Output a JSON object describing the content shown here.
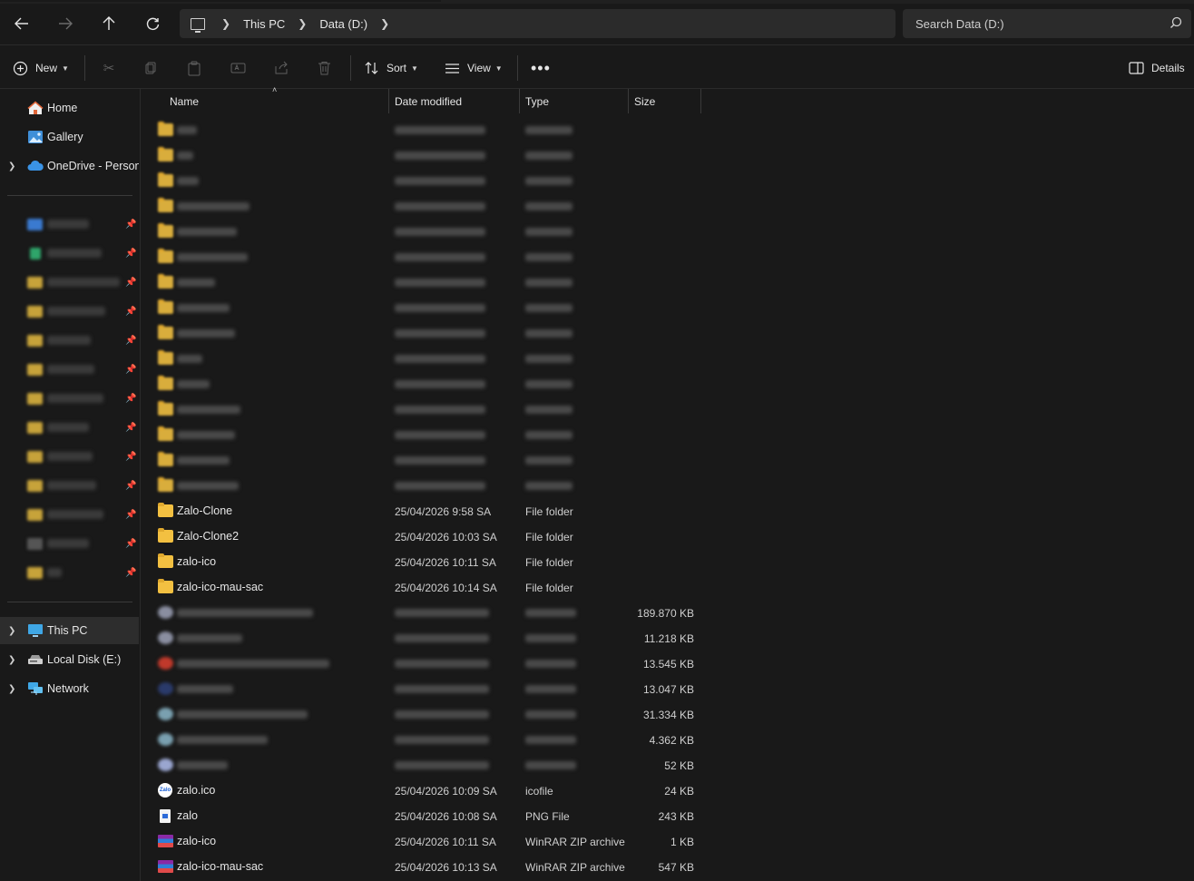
{
  "navigation": {
    "breadcrumb": [
      "This PC",
      "Data (D:)"
    ],
    "search_placeholder": "Search Data (D:)"
  },
  "toolbar": {
    "new_label": "New",
    "sort_label": "Sort",
    "view_label": "View",
    "details_label": "Details"
  },
  "sidebar": {
    "home": "Home",
    "gallery": "Gallery",
    "onedrive": "OneDrive - Persona",
    "this_pc": "This PC",
    "local_disk": "Local Disk (E:)",
    "network": "Network"
  },
  "columns": {
    "name": "Name",
    "date": "Date modified",
    "type": "Type",
    "size": "Size"
  },
  "visible_files": [
    {
      "name": "Zalo-Clone",
      "date": "25/04/2026 9:58 SA",
      "type": "File folder",
      "size": "",
      "icon": "folder-icon"
    },
    {
      "name": "Zalo-Clone2",
      "date": "25/04/2026 10:03 SA",
      "type": "File folder",
      "size": "",
      "icon": "folder-icon"
    },
    {
      "name": "zalo-ico",
      "date": "25/04/2026 10:11 SA",
      "type": "File folder",
      "size": "",
      "icon": "folder-icon"
    },
    {
      "name": "zalo-ico-mau-sac",
      "date": "25/04/2026 10:14 SA",
      "type": "File folder",
      "size": "",
      "icon": "folder-icon"
    },
    {
      "name": "zalo.ico",
      "date": "25/04/2026 10:09 SA",
      "type": "icofile",
      "size": "24 KB",
      "icon": "zalo-icon"
    },
    {
      "name": "zalo",
      "date": "25/04/2026 10:08 SA",
      "type": "PNG File",
      "size": "243 KB",
      "icon": "png-file-icon"
    },
    {
      "name": "zalo-ico",
      "date": "25/04/2026 10:11 SA",
      "type": "WinRAR ZIP archive",
      "size": "1 KB",
      "icon": "winrar-icon"
    },
    {
      "name": "zalo-ico-mau-sac",
      "date": "25/04/2026 10:13 SA",
      "type": "WinRAR ZIP archive",
      "size": "547 KB",
      "icon": "winrar-icon"
    }
  ],
  "blurred_file_sizes": [
    "189.870 KB",
    "11.218 KB",
    "13.545 KB",
    "13.047 KB",
    "31.334 KB",
    "4.362 KB",
    "52 KB"
  ],
  "colors": {
    "background": "#191919",
    "folder": "#f3c041",
    "selected": "#2d2d2d"
  }
}
